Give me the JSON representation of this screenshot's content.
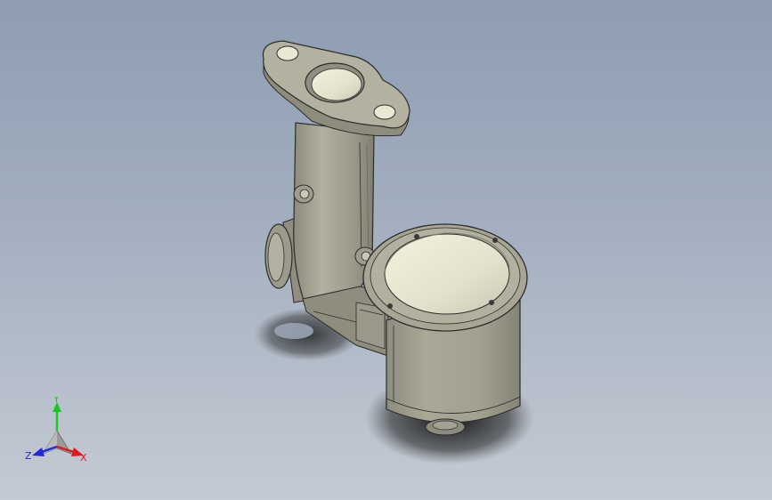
{
  "viewport": {
    "background_top": "#8e9db2",
    "background_bottom": "#c4cad3"
  },
  "model": {
    "body_color": "#a4a392",
    "interior_color": "#ecebd6",
    "edge_color": "#2c2c2c"
  },
  "triad": {
    "x_label": "X",
    "y_label": "Y",
    "z_label": "Z",
    "x_color": "#e01919",
    "y_color": "#17c81c",
    "z_color": "#1f2bd8"
  }
}
